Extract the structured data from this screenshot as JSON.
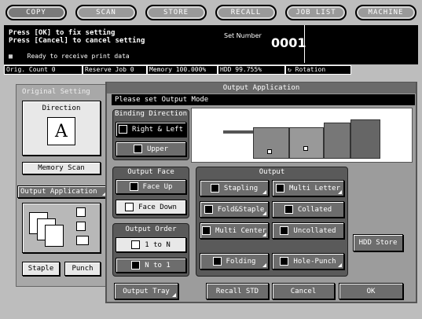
{
  "tabs": [
    {
      "label": "COPY",
      "active": true
    },
    {
      "label": "SCAN",
      "active": false
    },
    {
      "label": "STORE",
      "active": false
    },
    {
      "label": "RECALL",
      "active": false
    },
    {
      "label": "JOB LIST",
      "active": false
    },
    {
      "label": "MACHINE",
      "active": false
    }
  ],
  "message": {
    "line1": "Press [OK] to fix setting",
    "line2": "Press [Cancel] to cancel setting",
    "ready": "Ready to receive print data",
    "set_number_label": "Set Number",
    "set_number": "0001"
  },
  "status": {
    "orig_count": "Orig. Count    0",
    "reserve_job": "Reserve Job    0",
    "memory": "Memory  100.000%",
    "hdd": "HDD      99.755%",
    "rotation": "Rotation"
  },
  "left": {
    "original_setting": "Original Setting",
    "direction": "Direction",
    "direction_value": "A",
    "memory_scan": "Memory Scan",
    "output_application": "Output Application",
    "staple": "Staple",
    "punch": "Punch"
  },
  "dialog": {
    "title": "Output Application",
    "prompt": "Please set Output Mode",
    "binding_direction": "Binding Direction",
    "right_left": "Right & Left",
    "upper": "Upper",
    "output_face": "Output Face",
    "face_up": "Face Up",
    "face_down": "Face Down",
    "output_order": "Output Order",
    "one_to_n": "1 to N",
    "n_to_one": "N to 1",
    "output": "Output",
    "stapling": "Stapling",
    "multi_letter": "Multi Letter",
    "fold_staple": "Fold&Staple",
    "collated": "Collated",
    "multi_center": "Multi Center",
    "uncollated": "Uncollated",
    "folding": "Folding",
    "hole_punch": "Hole-Punch",
    "hdd_store": "HDD Store",
    "output_tray": "Output Tray",
    "recall_std": "Recall STD",
    "cancel": "Cancel",
    "ok": "OK"
  }
}
